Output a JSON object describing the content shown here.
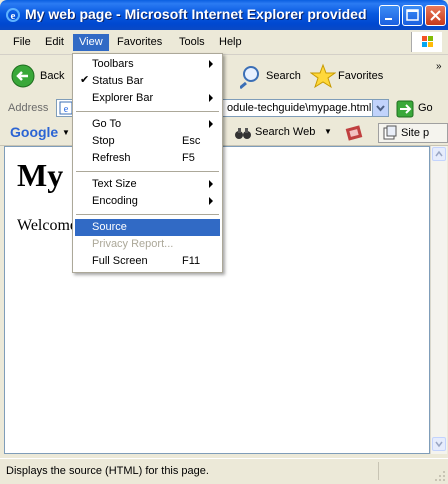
{
  "window": {
    "title": "My web page - Microsoft Internet Explorer provided b..."
  },
  "menubar": {
    "items": [
      "File",
      "Edit",
      "View",
      "Favorites",
      "Tools",
      "Help"
    ]
  },
  "toolbar": {
    "back_label": "Back",
    "search_label": "Search",
    "favorites_label": "Favorites"
  },
  "address": {
    "label": "Address",
    "value": "odule-techguide\\mypage.html",
    "go_label": "Go"
  },
  "googlebar": {
    "brand": "Google",
    "search_web_label": "Search Web",
    "site_label": "Site p"
  },
  "page": {
    "heading": "My",
    "paragraph": "Welcome"
  },
  "view_menu": {
    "items": [
      {
        "label": "Toolbars",
        "shortcut": "",
        "submenu": true,
        "checked": false,
        "disabled": false,
        "highlighted": false
      },
      {
        "label": "Status Bar",
        "shortcut": "",
        "submenu": false,
        "checked": true,
        "disabled": false,
        "highlighted": false
      },
      {
        "label": "Explorer Bar",
        "shortcut": "",
        "submenu": true,
        "checked": false,
        "disabled": false,
        "highlighted": false
      },
      {
        "label": "Go To",
        "shortcut": "",
        "submenu": true,
        "checked": false,
        "disabled": false,
        "highlighted": false
      },
      {
        "label": "Stop",
        "shortcut": "Esc",
        "submenu": false,
        "checked": false,
        "disabled": false,
        "highlighted": false
      },
      {
        "label": "Refresh",
        "shortcut": "F5",
        "submenu": false,
        "checked": false,
        "disabled": false,
        "highlighted": false
      },
      {
        "label": "Text Size",
        "shortcut": "",
        "submenu": true,
        "checked": false,
        "disabled": false,
        "highlighted": false
      },
      {
        "label": "Encoding",
        "shortcut": "",
        "submenu": true,
        "checked": false,
        "disabled": false,
        "highlighted": false
      },
      {
        "label": "Source",
        "shortcut": "",
        "submenu": false,
        "checked": false,
        "disabled": false,
        "highlighted": true
      },
      {
        "label": "Privacy Report...",
        "shortcut": "",
        "submenu": false,
        "checked": false,
        "disabled": true,
        "highlighted": false
      },
      {
        "label": "Full Screen",
        "shortcut": "F11",
        "submenu": false,
        "checked": false,
        "disabled": false,
        "highlighted": false
      }
    ]
  },
  "statusbar": {
    "text": "Displays the source (HTML) for this page."
  },
  "colors": {
    "title_blue": "#0a5fe0",
    "highlight": "#316ac5",
    "chrome": "#ece9d8"
  }
}
